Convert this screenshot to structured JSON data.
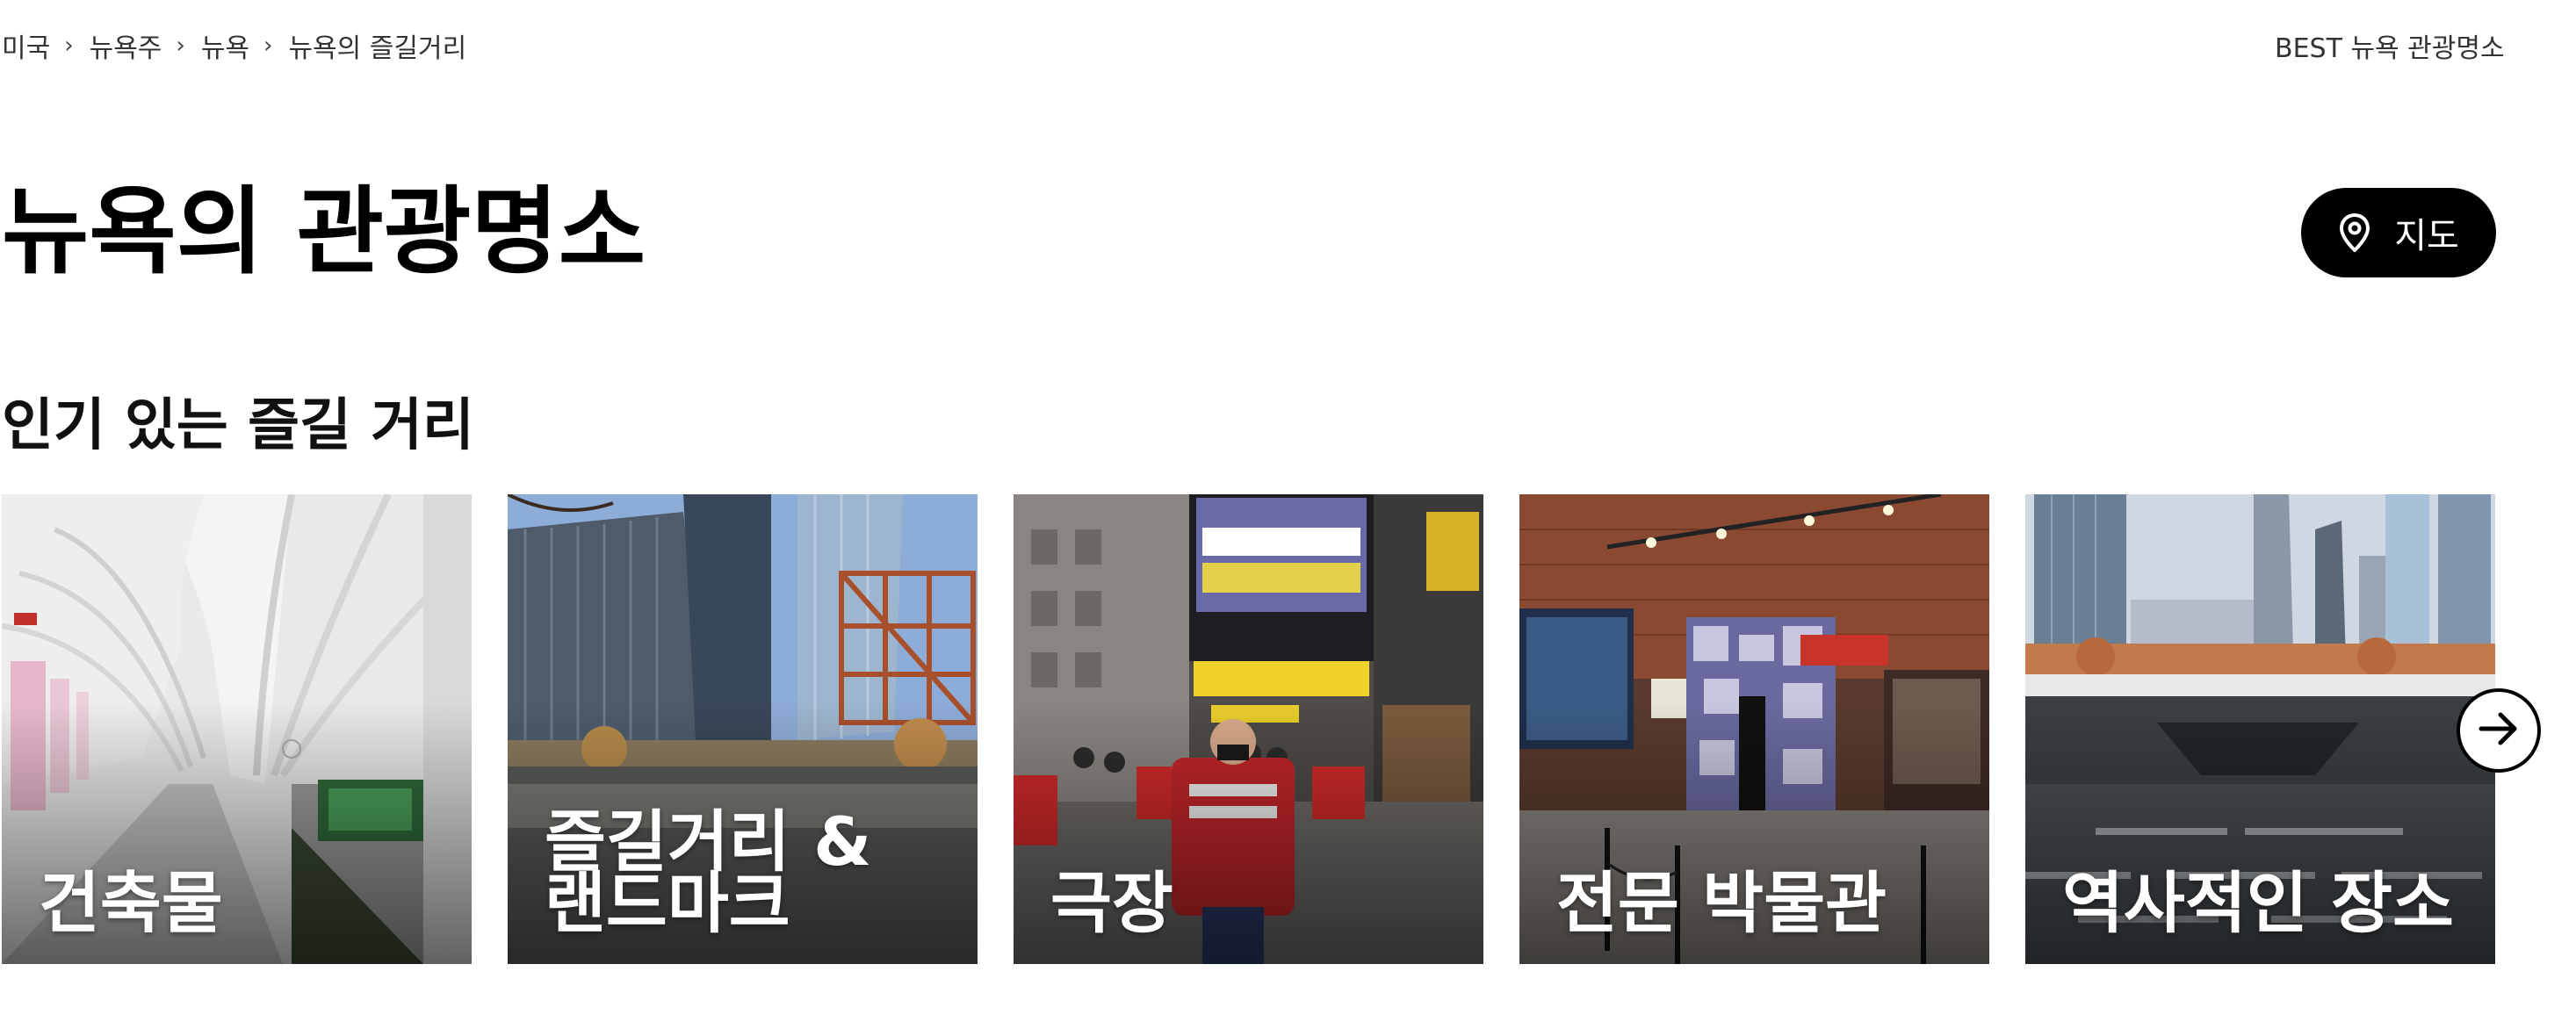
{
  "breadcrumb": {
    "items": [
      "미국",
      "뉴욕주",
      "뉴욕",
      "뉴욕의 즐길거리"
    ],
    "separator": "›"
  },
  "header": {
    "best_link": "BEST 뉴욕 관광명소"
  },
  "page_title": "뉴욕의 관광명소",
  "map_button": {
    "label": "지도",
    "icon": "map-pin-icon"
  },
  "section": {
    "title": "인기 있는 즐길 거리"
  },
  "cards": [
    {
      "label": "건축물",
      "image": "oculus-white-arched-corridor"
    },
    {
      "label": "즐길거리 & 랜드마크",
      "image": "world-trade-center-towers-construction"
    },
    {
      "label": "극장",
      "image": "broadway-theater-american-utopia"
    },
    {
      "label": "전문 박물관",
      "image": "museum-exhibit-interior"
    },
    {
      "label": "역사적인 장소",
      "image": "911-memorial-pool"
    }
  ],
  "carousel": {
    "next_icon": "arrow-right-icon"
  }
}
